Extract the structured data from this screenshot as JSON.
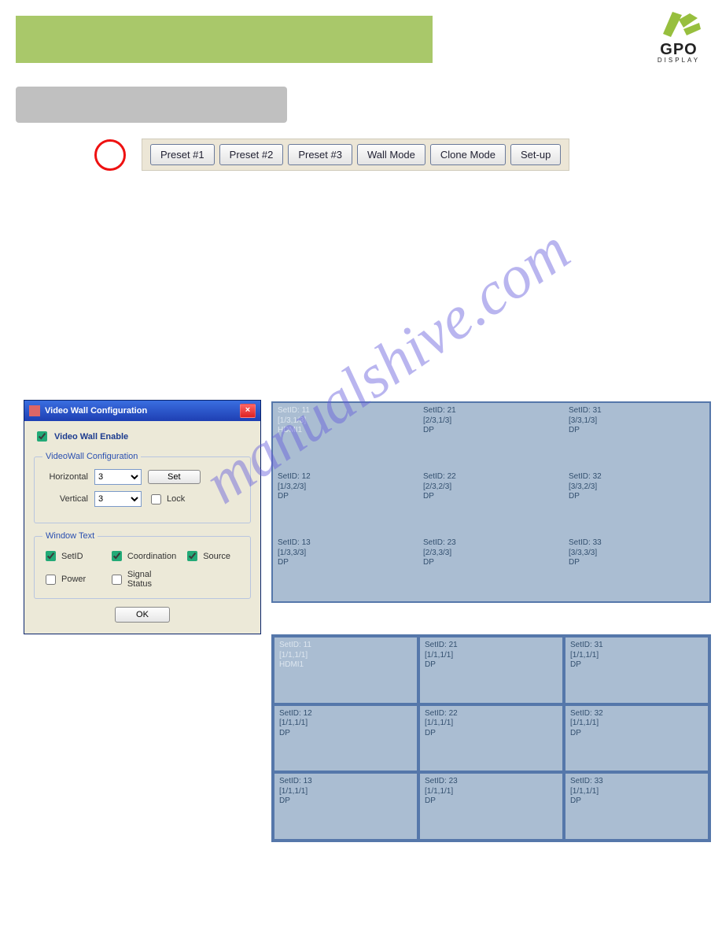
{
  "watermark": "manualshive.com",
  "logo": {
    "main": "GPO",
    "sub": "DISPLAY"
  },
  "toolbar": {
    "preset1": "Preset #1",
    "preset2": "Preset #2",
    "preset3": "Preset #3",
    "wallmode": "Wall Mode",
    "clonemode": "Clone Mode",
    "setup": "Set-up"
  },
  "dialog": {
    "title": "Video Wall Configuration",
    "close": "×",
    "enable_label": "Video Wall Enable",
    "enable_checked": true,
    "fs_config_legend": "VideoWall Configuration",
    "horizontal_label": "Horizontal",
    "horizontal_value": "3",
    "vertical_label": "Vertical",
    "vertical_value": "3",
    "set_btn": "Set",
    "lock_label": "Lock",
    "lock_checked": false,
    "fs_window_legend": "Window Text",
    "chk_setid": "SetID",
    "chk_setid_checked": true,
    "chk_coord": "Coordination",
    "chk_coord_checked": true,
    "chk_source": "Source",
    "chk_source_checked": true,
    "chk_power": "Power",
    "chk_power_checked": false,
    "chk_signal": "Signal Status",
    "chk_signal_checked": false,
    "ok_btn": "OK"
  },
  "grids": {
    "merged": [
      {
        "sid": "SetID: 11",
        "coord": "[1/3,1/3]",
        "src": "HDMI1",
        "first": true
      },
      {
        "sid": "SetID: 21",
        "coord": "[2/3,1/3]",
        "src": "DP"
      },
      {
        "sid": "SetID: 31",
        "coord": "[3/3,1/3]",
        "src": "DP"
      },
      {
        "sid": "SetID: 12",
        "coord": "[1/3,2/3]",
        "src": "DP"
      },
      {
        "sid": "SetID: 22",
        "coord": "[2/3,2/3]",
        "src": "DP"
      },
      {
        "sid": "SetID: 32",
        "coord": "[3/3,2/3]",
        "src": "DP"
      },
      {
        "sid": "SetID: 13",
        "coord": "[1/3,3/3]",
        "src": "DP"
      },
      {
        "sid": "SetID: 23",
        "coord": "[2/3,3/3]",
        "src": "DP"
      },
      {
        "sid": "SetID: 33",
        "coord": "[3/3,3/3]",
        "src": "DP"
      }
    ],
    "clone": [
      {
        "sid": "SetID: 11",
        "coord": "[1/1,1/1]",
        "src": "HDMI1",
        "first": true
      },
      {
        "sid": "SetID: 21",
        "coord": "[1/1,1/1]",
        "src": "DP"
      },
      {
        "sid": "SetID: 31",
        "coord": "[1/1,1/1]",
        "src": "DP"
      },
      {
        "sid": "SetID: 12",
        "coord": "[1/1,1/1]",
        "src": "DP"
      },
      {
        "sid": "SetID: 22",
        "coord": "[1/1,1/1]",
        "src": "DP"
      },
      {
        "sid": "SetID: 32",
        "coord": "[1/1,1/1]",
        "src": "DP"
      },
      {
        "sid": "SetID: 13",
        "coord": "[1/1,1/1]",
        "src": "DP"
      },
      {
        "sid": "SetID: 23",
        "coord": "[1/1,1/1]",
        "src": "DP"
      },
      {
        "sid": "SetID: 33",
        "coord": "[1/1,1/1]",
        "src": "DP"
      }
    ]
  }
}
